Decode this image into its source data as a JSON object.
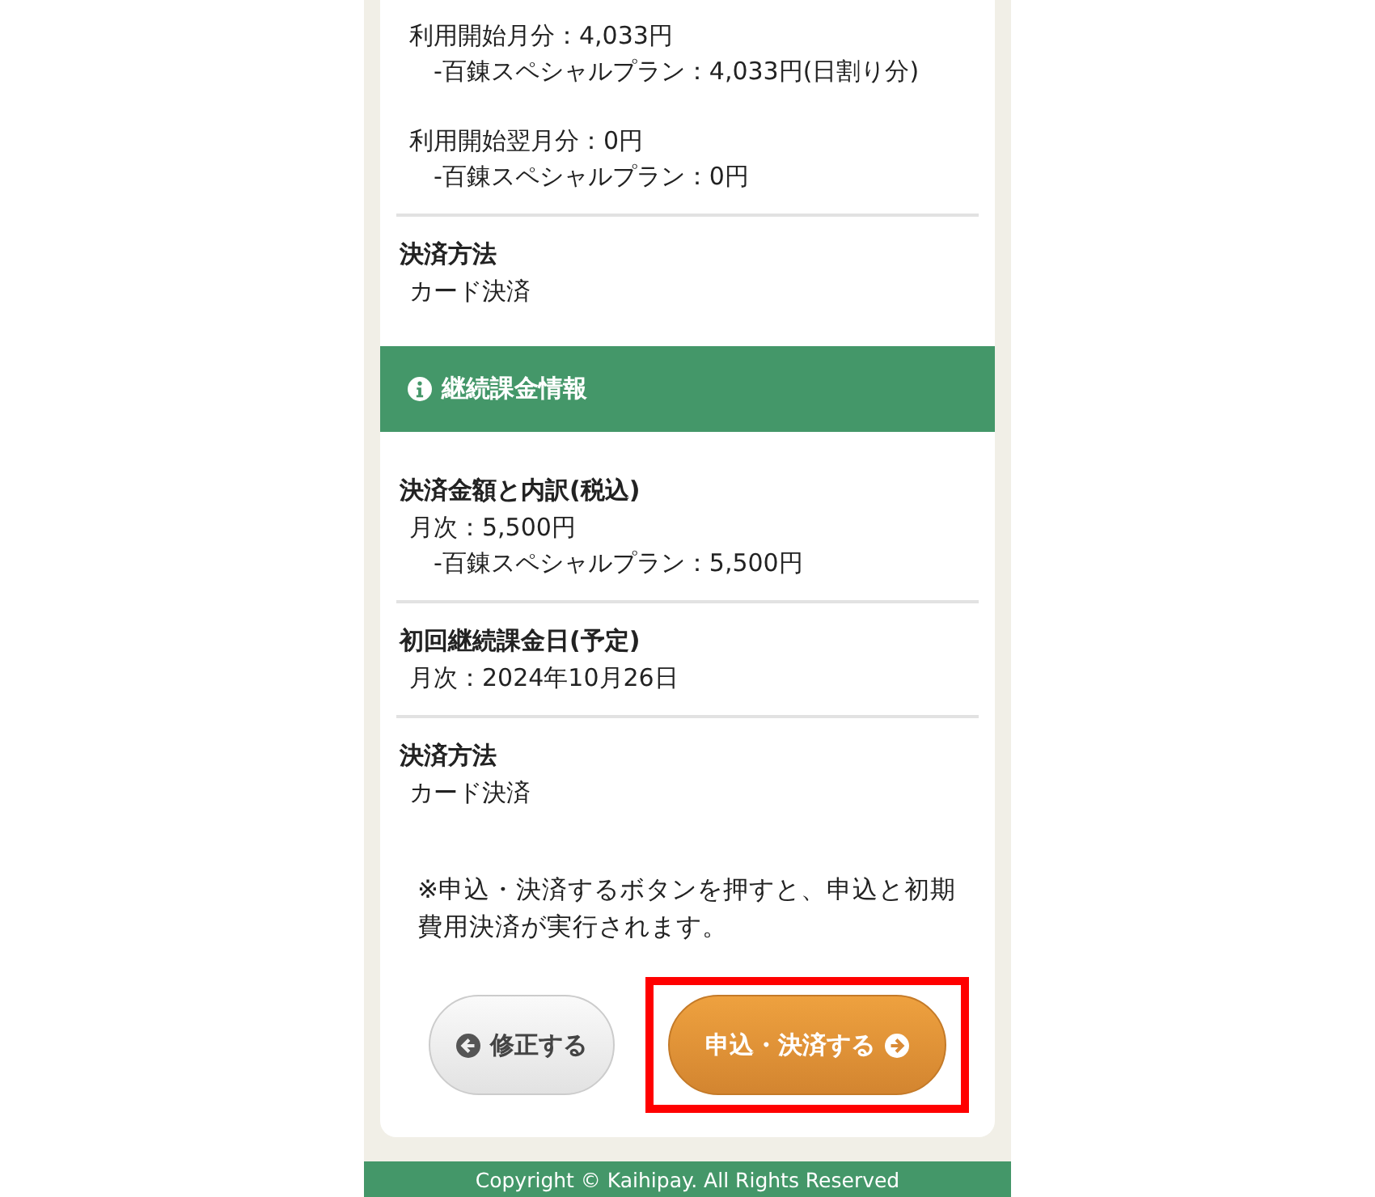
{
  "sections": [
    {
      "blocks": [
        {
          "groups": [
            [
              {
                "text": "利用開始月分：4,033円",
                "indented": false
              },
              {
                "text": "-百錬スペシャルプラン：4,033円(日割り分)",
                "indented": true
              }
            ],
            [
              {
                "text": "利用開始翌月分：0円",
                "indented": false
              },
              {
                "text": "-百錬スペシャルプラン：0円",
                "indented": true
              }
            ]
          ]
        },
        {
          "title": "決済方法",
          "groups": [
            [
              {
                "text": "カード決済",
                "indented": false
              }
            ]
          ]
        }
      ]
    },
    {
      "header": "継続課金情報",
      "blocks": [
        {
          "title": "決済金額と内訳(税込)",
          "groups": [
            [
              {
                "text": "月次：5,500円",
                "indented": false
              },
              {
                "text": "-百錬スペシャルプラン：5,500円",
                "indented": true
              }
            ]
          ]
        },
        {
          "title": "初回継続課金日(予定)",
          "groups": [
            [
              {
                "text": "月次：2024年10月26日",
                "indented": false
              }
            ]
          ]
        },
        {
          "title": "決済方法",
          "groups": [
            [
              {
                "text": "カード決済",
                "indented": false
              }
            ]
          ]
        }
      ]
    }
  ],
  "note": "※申込・決済するボタンを押すと、申込と初期費用決済が実行されます。",
  "buttons": [
    {
      "label": "修正する",
      "kind": "back",
      "highlighted": false
    },
    {
      "label": "申込・決済する",
      "kind": "submit",
      "highlighted": true
    }
  ],
  "footer": "Copyright © Kaihipay. All Rights Reserved"
}
